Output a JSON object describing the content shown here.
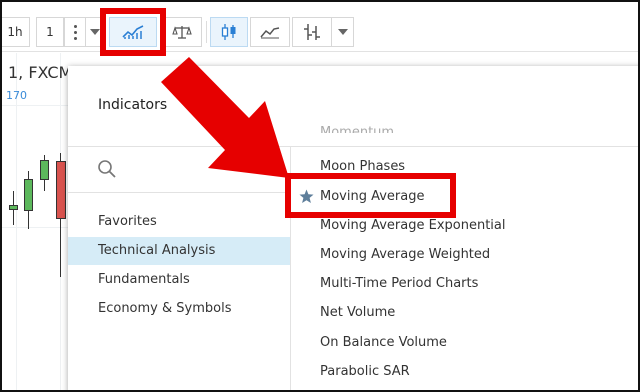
{
  "toolbar": {
    "interval": "1h",
    "multiplier": "1",
    "accent": "#2a7fd4"
  },
  "chart": {
    "symbol": "1, FXCM",
    "value": "170",
    "up_color": "#5cb85c",
    "down_color": "#d9534f"
  },
  "dialog": {
    "title": "Indicators",
    "categories": [
      "Favorites",
      "Technical Analysis",
      "Fundamentals",
      "Economy & Symbols"
    ],
    "active_category": "Technical Analysis",
    "indicators": [
      "Moon Phases",
      "Moving Average",
      "Moving Average Exponential",
      "Moving Average Weighted",
      "Multi-Time Period Charts",
      "Net Volume",
      "On Balance Volume",
      "Parabolic SAR"
    ],
    "favorited": "Moving Average"
  },
  "annotation": {
    "color": "#e60000"
  }
}
